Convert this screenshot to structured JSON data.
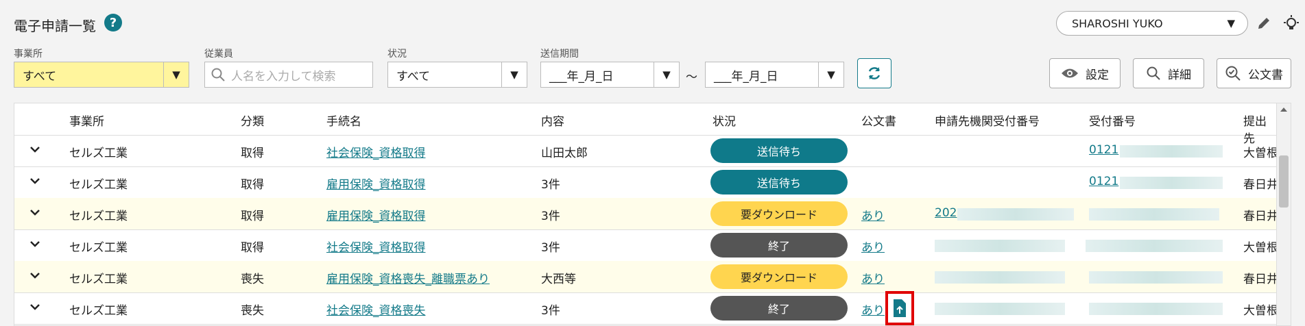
{
  "page": {
    "title": "電子申請一覧"
  },
  "user": {
    "name": "SHAROSHI YUKO"
  },
  "filters": {
    "office": {
      "label": "事業所",
      "value": "すべて"
    },
    "employee": {
      "label": "従業員",
      "placeholder": "人名を入力して検索"
    },
    "status": {
      "label": "状況",
      "value": "すべて"
    },
    "period": {
      "label": "送信期間",
      "from": "___年_月_日",
      "to": "___年_月_日",
      "sep": "～"
    }
  },
  "tools": {
    "settings": "設定",
    "details": "詳細",
    "official": "公文書"
  },
  "table": {
    "headers": [
      "事業所",
      "分類",
      "手続名",
      "内容",
      "状況",
      "公文書",
      "申請先機関受付番号",
      "受付番号",
      "提出先"
    ],
    "rows": [
      {
        "office": "セルズ工業",
        "category": "取得",
        "procedure": "社会保険_資格取得",
        "content": "山田太郎",
        "status": "送信待ち",
        "official": "",
        "agency": "",
        "receipt": "0121",
        "dest": "大曽根"
      },
      {
        "office": "セルズ工業",
        "category": "取得",
        "procedure": "雇用保険_資格取得",
        "content": "3件",
        "status": "送信待ち",
        "official": "",
        "agency": "",
        "receipt": "0121",
        "dest": "春日井"
      },
      {
        "office": "セルズ工業",
        "category": "取得",
        "procedure": "雇用保険_資格取得",
        "content": "3件",
        "status": "要ダウンロード",
        "official": "あり",
        "agency": "202",
        "receipt": "",
        "dest": "春日井"
      },
      {
        "office": "セルズ工業",
        "category": "取得",
        "procedure": "社会保険_資格取得",
        "content": "3件",
        "status": "終了",
        "official": "あり",
        "agency": "",
        "receipt": "",
        "dest": "大曽根"
      },
      {
        "office": "セルズ工業",
        "category": "喪失",
        "procedure": "雇用保険_資格喪失_離職票あり",
        "content": "大西等",
        "status": "要ダウンロード",
        "official": "あり",
        "agency": "",
        "receipt": "",
        "dest": "春日井"
      },
      {
        "office": "セルズ工業",
        "category": "喪失",
        "procedure": "社会保険_資格喪失",
        "content": "3件",
        "status": "終了",
        "official": "あり",
        "agency": "",
        "receipt": "",
        "dest": "大曽根"
      }
    ]
  },
  "colors": {
    "accent": "#137a89",
    "wait": "#0f7a8a",
    "download": "#ffd54f",
    "end": "#555555",
    "highlight": "#e00000"
  }
}
